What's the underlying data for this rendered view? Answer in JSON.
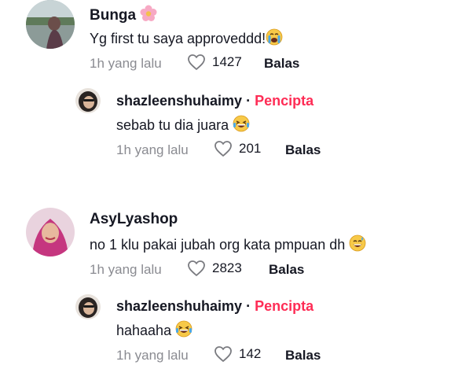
{
  "comments": [
    {
      "user": "Bunga",
      "user_emoji": "flower-icon",
      "text": "Yg first tu saya approveddd!",
      "emoji": "crying-face-icon",
      "time": "1h yang lalu",
      "likes": "1427",
      "reply_label": "Balas",
      "reply": {
        "user": "shazleenshuhaimy",
        "separator": "·",
        "badge": "Pencipta",
        "text": "sebab tu dia juara",
        "emoji": "laughing-face-icon",
        "time": "1h yang lalu",
        "likes": "201",
        "reply_label": "Balas"
      }
    },
    {
      "user": "AsyLyashop",
      "text": "no 1 klu pakai jubah org kata pmpuan dh",
      "emoji": "sweat-smile-icon",
      "time": "1h yang lalu",
      "likes": "2823",
      "reply_label": "Balas",
      "reply": {
        "user": "shazleenshuhaimy",
        "separator": "·",
        "badge": "Pencipta",
        "text": "hahaaha",
        "emoji": "laughing-face-icon",
        "time": "1h yang lalu",
        "likes": "142",
        "reply_label": "Balas"
      }
    }
  ],
  "colors": {
    "creator_badge": "#fe2c55",
    "meta_text": "#8a8b91",
    "text": "#161823"
  }
}
